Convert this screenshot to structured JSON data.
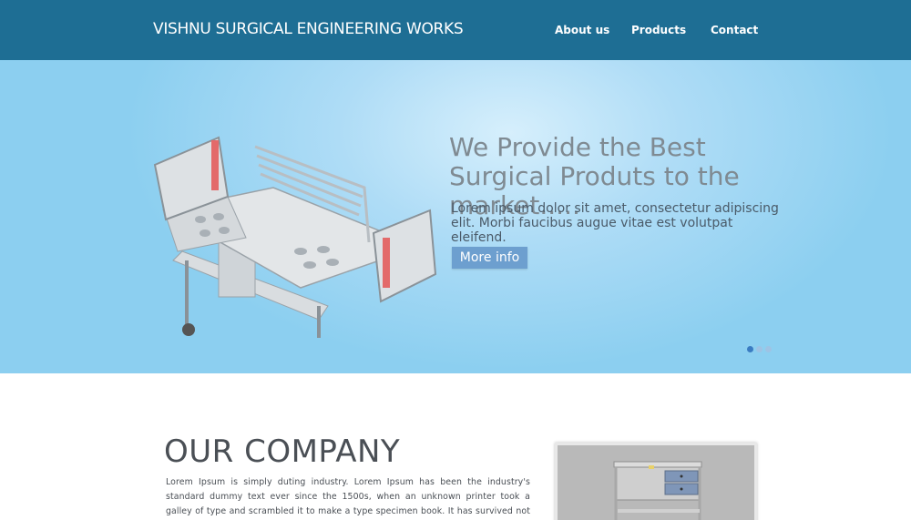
{
  "header": {
    "brand": "VISHNU SURGICAL ENGINEERING WORKS",
    "nav": [
      "About us",
      "Products",
      "Contact"
    ],
    "background": "#1e6e94"
  },
  "hero": {
    "title": "We Provide the Best Surgical Produts to the market.....",
    "text": "Lorem ipsum dolor sit amet, consectetur adipiscing elit. Morbi faucibus augue vitae est volutpat eleifend.",
    "button": "More info",
    "slides_total": 3,
    "slide_active": 1
  },
  "company": {
    "title": "OUR COMPANY",
    "text": "Lorem Ipsum is simply duting industry. Lorem Ipsum has been the industry's standard dummy text ever since the 1500s, when an unknown printer took a galley of type and scrambled it to make a type specimen book. It has survived not only five centuries, but also the leap into"
  }
}
